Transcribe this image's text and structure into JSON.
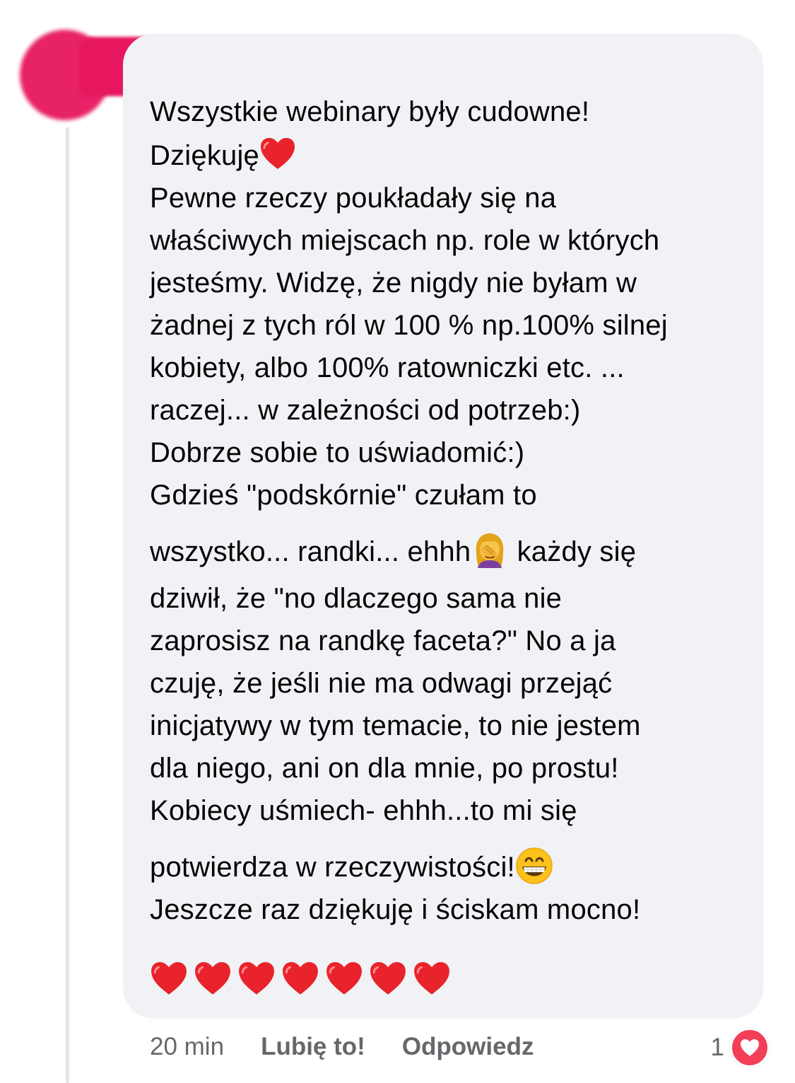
{
  "comment": {
    "lines": [
      "Wszystkie webinary były cudowne!",
      "Dziękuję",
      "Pewne rzeczy poukładały się na",
      "właściwych miejscach np. role w których",
      "jesteśmy. Widzę, że nigdy nie byłam w",
      "żadnej z tych ról w 100 % np.100% silnej",
      "kobiety, albo 100% ratowniczki etc. ...",
      "raczej... w zależności od potrzeb:)",
      "Dobrze sobie to uświadomić:)",
      "Gdzieś \"podskórnie\" czułam to",
      "wszystko... randki... ehhh",
      " każdy się",
      "dziwił, że \"no dlaczego sama nie",
      "zaprosisz na randkę faceta?\" No a ja",
      "czuję, że jeśli nie ma odwagi przejąć",
      "inicjatywy w tym temacie, to nie jestem",
      "dla niego, ani on dla mnie, po prostu!",
      "Kobiecy uśmiech- ehhh...to mi się",
      "potwierdza w rzeczywistości!",
      "Jeszcze raz dziękuję i ściskam mocno!"
    ],
    "hearts_count": 7,
    "emojis": {
      "after_thanks": "red-heart",
      "after_ehhh": "woman-facepalming",
      "after_reality": "grinning-face"
    }
  },
  "actions": {
    "time": "20 min",
    "like": "Lubię to!",
    "reply": "Odpowiedz"
  },
  "reactions": {
    "count": "1",
    "type": "love"
  },
  "colors": {
    "bubble": "#f0f2f5",
    "text": "#050505",
    "muted": "#65676b",
    "heart": "#e8232b",
    "love_badge": "#f33e58",
    "redaction": "#e6175f"
  }
}
